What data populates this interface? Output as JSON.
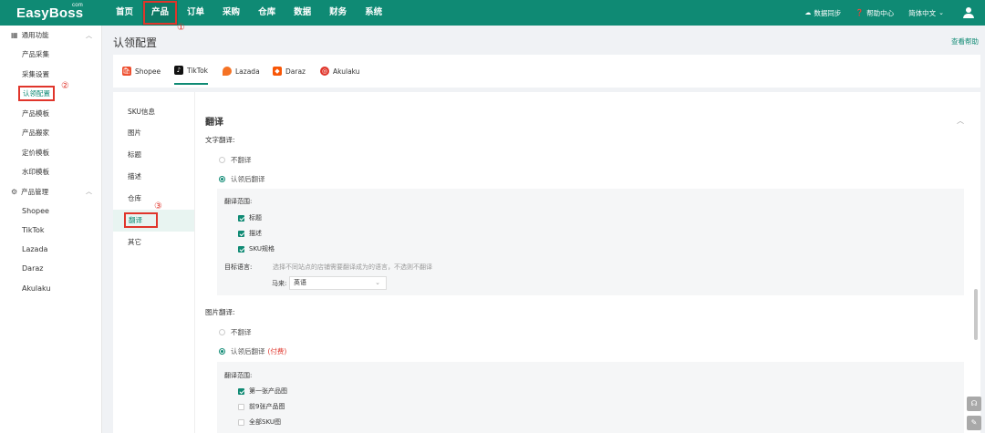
{
  "app": {
    "logo": "EasyBoss",
    "logo_sup": "com"
  },
  "topnav": [
    "首页",
    "产品",
    "订单",
    "采购",
    "仓库",
    "数据",
    "财务",
    "系统"
  ],
  "top_right": {
    "sync": "数据同步",
    "help": "帮助中心",
    "lang": "简体中文"
  },
  "sidebar": {
    "group1": "通用功能",
    "group1_items": [
      "产品采集",
      "采集设置",
      "认领配置",
      "产品模板",
      "产品搬家",
      "定价模板",
      "水印模板"
    ],
    "group2": "产品管理",
    "group2_items": [
      "Shopee",
      "TikTok",
      "Lazada",
      "Daraz",
      "Akulaku"
    ]
  },
  "page": {
    "title": "认领配置",
    "help": "查看帮助"
  },
  "platform_tabs": [
    "Shopee",
    "TikTok",
    "Lazada",
    "Daraz",
    "Akulaku"
  ],
  "subnav": [
    "SKU信息",
    "图片",
    "标题",
    "描述",
    "仓库",
    "翻译",
    "其它"
  ],
  "section": {
    "title": "翻译",
    "text_translate": {
      "label": "文字翻译:",
      "opt_no": "不翻译",
      "opt_yes": "认领后翻译",
      "scope_label": "翻译范围:",
      "scope_items": [
        "标题",
        "描述",
        "SKU规格"
      ],
      "target_label": "目标语言:",
      "target_hint": "选择不同站点的店铺需要翻译成为的语言，不选则不翻译",
      "site_label": "马来:",
      "site_value": "英语"
    },
    "image_translate": {
      "label": "图片翻译:",
      "opt_no": "不翻译",
      "opt_yes": "认领后翻译",
      "paid": "(付费)",
      "scope_label": "翻译范围:",
      "scope_items": [
        "第一张产品图",
        "前9张产品图",
        "全部SKU图"
      ]
    }
  },
  "annotations": [
    "①",
    "②",
    "③"
  ],
  "colors": {
    "brand": "#0f8a74",
    "highlight": "#e0352b"
  }
}
